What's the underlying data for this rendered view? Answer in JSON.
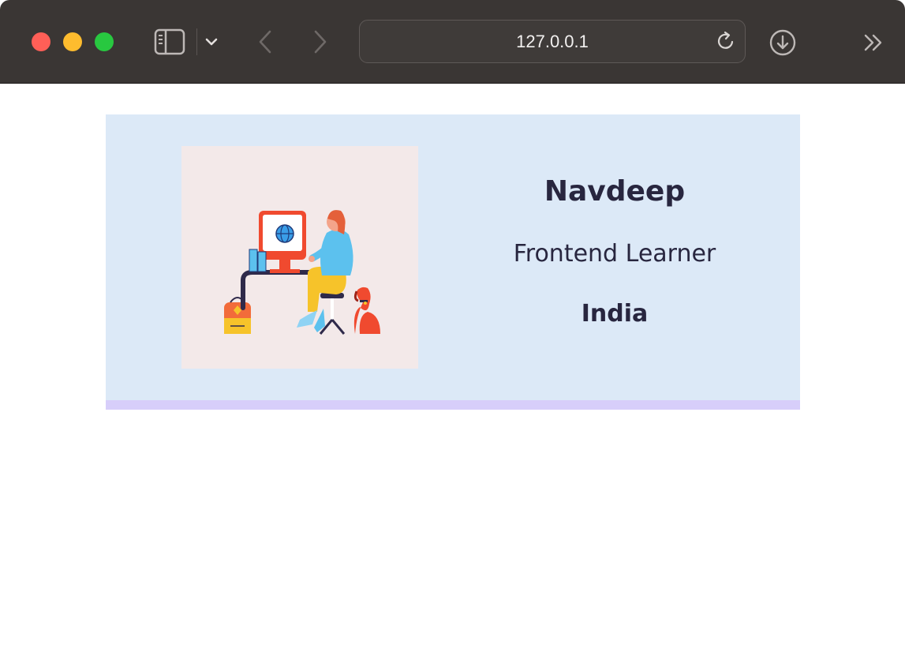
{
  "browser": {
    "url": "127.0.0.1",
    "icons": {
      "sidebar": "sidebar-icon",
      "dropdown": "chevron-down-icon",
      "back": "chevron-left-icon",
      "forward": "chevron-right-icon",
      "reload": "reload-icon",
      "download": "download-icon",
      "more": "double-chevron-right-icon"
    }
  },
  "profile": {
    "name": "Navdeep",
    "role": "Frontend Learner",
    "location": "India",
    "illustration": "person-at-computer-illustration"
  },
  "colors": {
    "card_background": "#dce9f7",
    "card_border_bottom": "#d7cefa",
    "illustration_background": "#f3e9e9",
    "text": "#28263f",
    "toolbar": "#3a3634"
  }
}
